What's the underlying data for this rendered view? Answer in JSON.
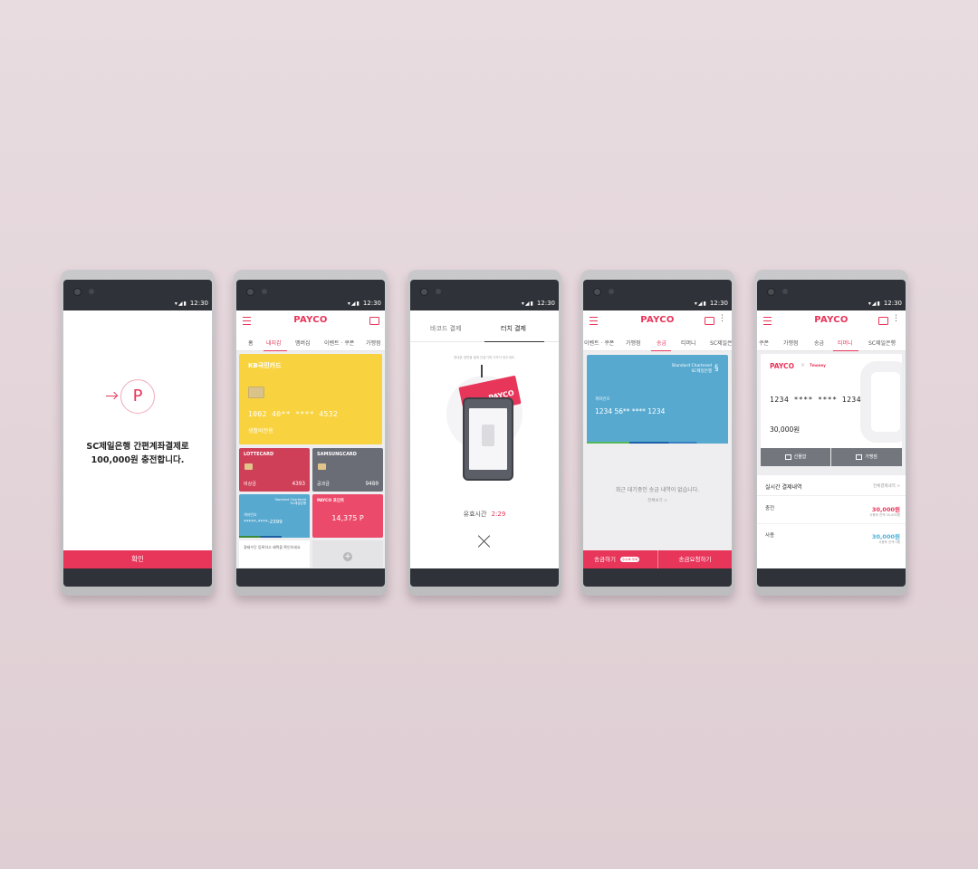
{
  "status_time": "12:30",
  "phone1": {
    "headline": "SC제일은행 간편계좌결제로",
    "subline": "100,000원 충전합니다.",
    "logo_letter": "P",
    "confirm_label": "확인"
  },
  "phone2": {
    "logo": "PAYCO",
    "tabs": [
      "홈",
      "내지갑",
      "멤버십",
      "이벤트 · 쿠폰",
      "가맹점"
    ],
    "kb_card": {
      "brand": "KB국민카드",
      "number": "1002 40** **** 4532",
      "name": "생활비전용"
    },
    "lotte_card": {
      "brand": "LOTTECARD",
      "name": "비상금",
      "last4": "4393"
    },
    "samsung_card": {
      "brand": "SAMSUNGCARD",
      "name": "공과금",
      "last4": "9480"
    },
    "sc_card": {
      "brand": "Standard Chartered SC제일은행",
      "label": "계좌번호",
      "number": "*****-****-2399"
    },
    "payco_point": {
      "brand": "PAYCO 포인트",
      "value": "14,375 P"
    },
    "note": "결제수단 등록하고 혜택을 확인하세요"
  },
  "phone3": {
    "tabs": [
      "바코드 결제",
      "터치 결제"
    ],
    "hint": "휴대폰 뒷면을 결제 단말기에 가까이 대주세요.",
    "timer_label": "유효시간",
    "timer_value": "2:29",
    "device_label": "PAYCO"
  },
  "phone4": {
    "logo": "PAYCO",
    "tabs": [
      "이벤트 · 쿠폰",
      "가맹점",
      "송금",
      "티머니",
      "SC제일은행"
    ],
    "card_brand_1": "Standard Chartered",
    "card_brand_2": "SC제일은행",
    "card_label": "계좌번호",
    "card_number": "1234 56** **** 1234",
    "empty_text": "최근 대기중인 송금 내역이 없습니다.",
    "more_link": "전체보기 >",
    "send_label": "송금하기",
    "send_badge": "수수료 무료",
    "request_label": "송금요청하기"
  },
  "phone5": {
    "logo": "PAYCO",
    "tabs": [
      "쿠폰",
      "가맹점",
      "송금",
      "티머니",
      "SC제일은행"
    ],
    "card_logo": "PAYCO",
    "card_partner": "Tmoney",
    "card_number": "1234 **** **** 1234",
    "balance": "30,000원",
    "gift_label": "선물함",
    "store_label": "가맹점",
    "history_title": "실시간 결제내역",
    "history_link": "전체결제내역 >",
    "rows": [
      {
        "label": "충전",
        "amount": "30,000원",
        "sub": "사용후 잔액 30,000원"
      },
      {
        "label": "사용",
        "amount": "30,000원",
        "sub": "사용후 잔액 0원"
      }
    ]
  },
  "colors": {
    "payco_red": "#e8355a",
    "kb_yellow": "#f8d33f",
    "lotte_red": "#cf3f57",
    "samsung_gray": "#6b6d76",
    "sc_blue": "#58a9d0",
    "background": "#e4d6da"
  }
}
